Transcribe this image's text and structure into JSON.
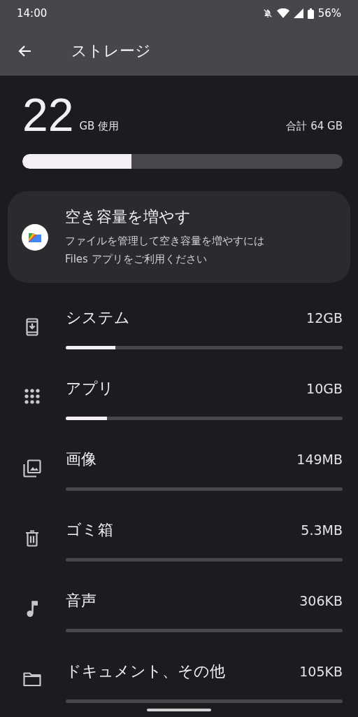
{
  "status_bar": {
    "time": "14:00",
    "battery": "56%"
  },
  "toolbar": {
    "title": "ストレージ"
  },
  "summary": {
    "used": "22",
    "used_unit": "GB 使用",
    "total": "合計 64 GB",
    "level": 0.34
  },
  "suggestion": {
    "title": "空き容量を増やす",
    "body": "ファイルを管理して空き容量を増やすには Files アプリをご利用ください"
  },
  "categories": [
    {
      "kind": "system",
      "name": "システム",
      "size": "12GB",
      "level": 0.18
    },
    {
      "kind": "apps",
      "name": "アプリ",
      "size": "10GB",
      "level": 0.15
    },
    {
      "kind": "images",
      "name": "画像",
      "size": "149MB"
    },
    {
      "kind": "trash",
      "name": "ゴミ箱",
      "size": "5.3MB"
    },
    {
      "kind": "audio",
      "name": "音声",
      "size": "306KB"
    },
    {
      "kind": "documents",
      "name": "ドキュメント、その他",
      "size": "105KB"
    }
  ]
}
